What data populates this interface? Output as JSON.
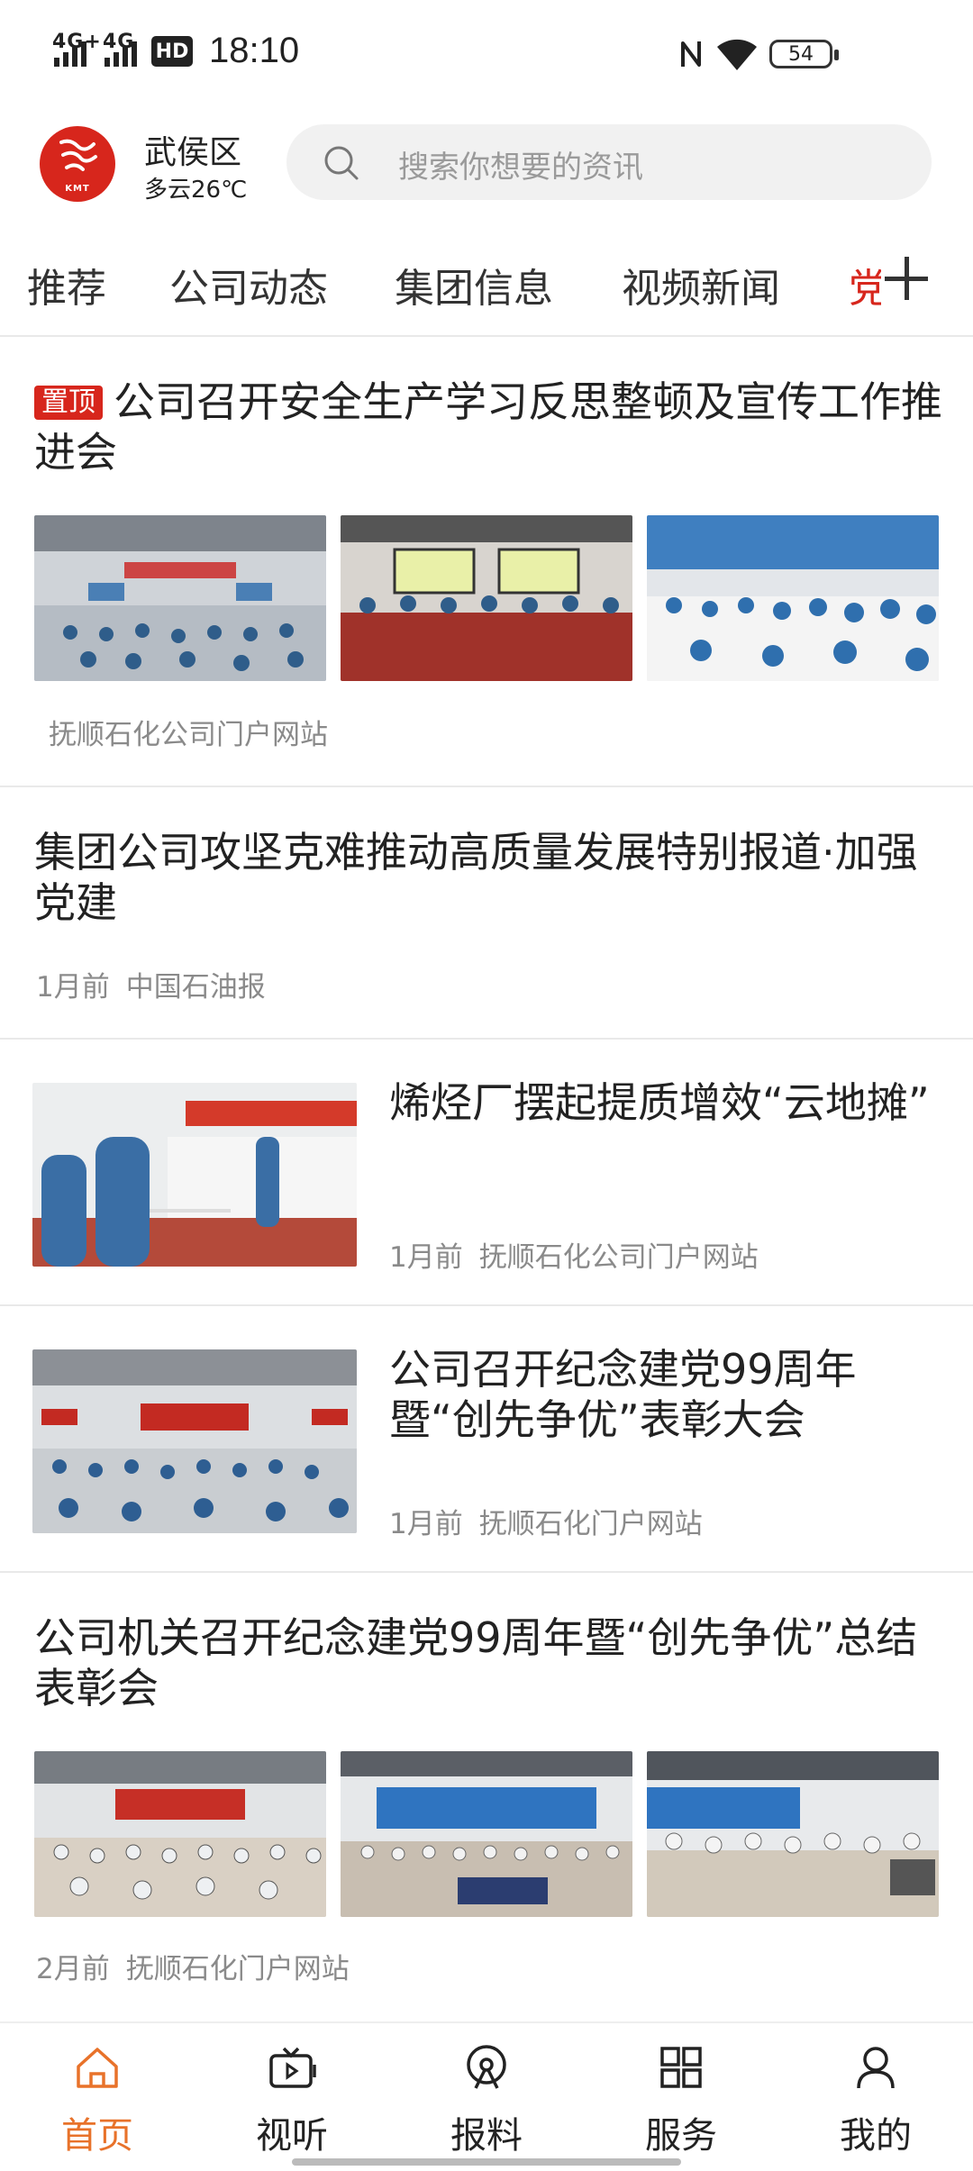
{
  "status_bar": {
    "network1": "4G+",
    "network2": "4G",
    "hd_badge": "HD",
    "time": "18:10",
    "battery": "54",
    "icons": [
      "signal-icon",
      "hd-voice-icon",
      "nfc-icon",
      "wifi-icon",
      "battery-icon"
    ]
  },
  "header": {
    "logo_text": "KMT",
    "location": "武侯区",
    "weather": "多云26℃",
    "search_placeholder": "搜索你想要的资讯"
  },
  "tabs": [
    "推荐",
    "公司动态",
    "集团信息",
    "视频新闻",
    "党"
  ],
  "feed": {
    "item1": {
      "pin": "置顶",
      "title": "公司召开安全生产学习反思整顿及宣传工作推进会",
      "source": "抚顺石化公司门户网站"
    },
    "item2": {
      "title": "集团公司攻坚克难推动高质量发展特别报道·加强党建",
      "time": "1月前",
      "source": "中国石油报"
    },
    "item3": {
      "title": "烯烃厂摆起提质增效“云地摊”",
      "time": "1月前",
      "source": "抚顺石化公司门户网站"
    },
    "item4": {
      "title": "公司召开纪念建党99周年暨“创先争优”表彰大会",
      "time": "1月前",
      "source": "抚顺石化门户网站"
    },
    "item5": {
      "title": "公司机关召开纪念建党99周年暨“创先争优”总结表彰会",
      "time": "2月前",
      "source": "抚顺石化门户网站"
    }
  },
  "bottom_nav": {
    "home": "首页",
    "video": "视听",
    "report": "报料",
    "service": "服务",
    "mine": "我的"
  },
  "colors": {
    "brand_red": "#d7261c",
    "active_orange": "#e8722a",
    "meta_gray": "#8a8a8a"
  }
}
